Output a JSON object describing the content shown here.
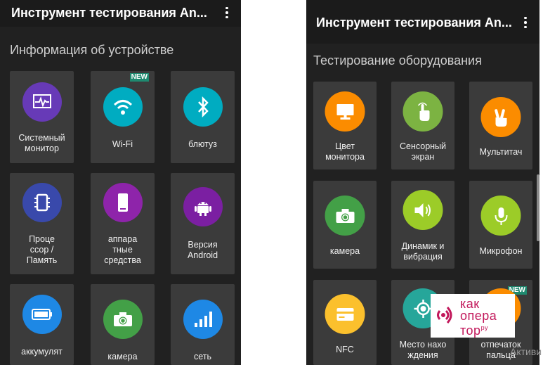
{
  "left_screen": {
    "title": "Инструмент тестирования An...",
    "section_title": "Информация об устройстве",
    "tiles": [
      {
        "label": "Системный монитор",
        "icon": "system-monitor-icon",
        "color": "#673ab7"
      },
      {
        "label": "Wi-Fi",
        "icon": "wifi-icon",
        "color": "#00acc1",
        "badge": "NEW"
      },
      {
        "label": "блютуз",
        "icon": "bluetooth-icon",
        "color": "#00acc1"
      },
      {
        "label": "Проце ссор / Память",
        "icon": "processor-icon",
        "color": "#3949ab"
      },
      {
        "label": "аппара тные средства",
        "icon": "hardware-phone-icon",
        "color": "#8e24aa"
      },
      {
        "label": "Версия Android",
        "icon": "android-icon",
        "color": "#7b1fa2"
      },
      {
        "label": "аккумулят",
        "icon": "battery-icon",
        "color": "#1e88e5"
      },
      {
        "label": "камера",
        "icon": "camera-icon",
        "color": "#43a047"
      },
      {
        "label": "сеть",
        "icon": "signal-icon",
        "color": "#1e88e5"
      }
    ]
  },
  "right_screen": {
    "title": "Инструмент тестирования An...",
    "section_title": "Тестирование оборудования",
    "tiles": [
      {
        "label": "Цвет монитора",
        "icon": "monitor-icon",
        "color": "#fb8c00"
      },
      {
        "label": "Сенсорный экран",
        "icon": "touch-icon",
        "color": "#7cb342"
      },
      {
        "label": "Мультитач",
        "icon": "multitouch-icon",
        "color": "#fb8c00"
      },
      {
        "label": "камера",
        "icon": "camera-icon",
        "color": "#43a047"
      },
      {
        "label": "Динамик и вибрация",
        "icon": "speaker-icon",
        "color": "#9ccc28"
      },
      {
        "label": "Микрофон",
        "icon": "microphone-icon",
        "color": "#9ccc28"
      },
      {
        "label": "NFC",
        "icon": "nfc-card-icon",
        "color": "#fbc02d"
      },
      {
        "label": "Место нахо ждения",
        "icon": "location-icon",
        "color": "#26a69a"
      },
      {
        "label": "отпечаток пальца",
        "icon": "fingerprint-icon",
        "color": "#fb8c00",
        "badge": "NEW"
      }
    ]
  },
  "watermark": {
    "line1": "как",
    "line2": "опера",
    "line3": "тор",
    "suffix": "ру"
  },
  "activation_text": "Активи"
}
